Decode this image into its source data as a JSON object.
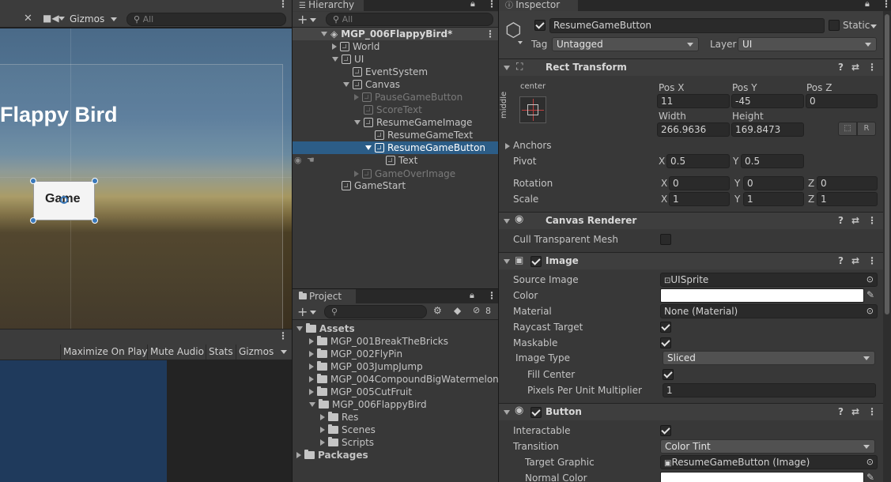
{
  "scene": {
    "toolbar": {
      "gizmos_label": "Gizmos",
      "search_placeholder": "All"
    },
    "title_text": "Flappy Bird",
    "button_text": "Game"
  },
  "game": {
    "toolbar": {
      "maximize": "Maximize On Play",
      "mute": "Mute Audio",
      "stats": "Stats",
      "gizmos": "Gizmos"
    }
  },
  "hierarchy": {
    "tab": "Hierarchy",
    "search_placeholder": "All",
    "scene_name": "MGP_006FlappyBird*",
    "items": [
      {
        "label": "World"
      },
      {
        "label": "UI"
      },
      {
        "label": "EventSystem"
      },
      {
        "label": "Canvas"
      },
      {
        "label": "PauseGameButton"
      },
      {
        "label": "ScoreText"
      },
      {
        "label": "ResumeGameImage"
      },
      {
        "label": "ResumeGameText"
      },
      {
        "label": "ResumeGameButton"
      },
      {
        "label": "Text"
      },
      {
        "label": "GameOverImage"
      },
      {
        "label": "GameStart"
      }
    ]
  },
  "project": {
    "tab": "Project",
    "badge": "8",
    "tree": [
      {
        "label": "Assets"
      },
      {
        "label": "MGP_001BreakTheBricks"
      },
      {
        "label": "MGP_002FlyPin"
      },
      {
        "label": "MGP_003JumpJump"
      },
      {
        "label": "MGP_004CompoundBigWatermelon"
      },
      {
        "label": "MGP_005CutFruit"
      },
      {
        "label": "MGP_006FlappyBird"
      },
      {
        "label": "Res"
      },
      {
        "label": "Scenes"
      },
      {
        "label": "Scripts"
      },
      {
        "label": "Packages"
      }
    ]
  },
  "inspector": {
    "tab": "Inspector",
    "object_name": "ResumeGameButton",
    "static_label": "Static",
    "tag_label": "Tag",
    "tag_value": "Untagged",
    "layer_label": "Layer",
    "layer_value": "UI",
    "rect_transform": {
      "title": "Rect Transform",
      "anchor_h": "center",
      "anchor_v": "middle",
      "pos_x_label": "Pos X",
      "pos_x": "11",
      "pos_y_label": "Pos Y",
      "pos_y": "-45",
      "pos_z_label": "Pos Z",
      "pos_z": "0",
      "width_label": "Width",
      "width": "266.9636",
      "height_label": "Height",
      "height": "169.8473",
      "r_button": "R",
      "anchors_label": "Anchors",
      "pivot_label": "Pivot",
      "pivot_x": "0.5",
      "pivot_y": "0.5",
      "rotation_label": "Rotation",
      "rot_x": "0",
      "rot_y": "0",
      "rot_z": "0",
      "scale_label": "Scale",
      "scale_x": "1",
      "scale_y": "1",
      "scale_z": "1",
      "x": "X",
      "y": "Y",
      "z": "Z"
    },
    "canvas_renderer": {
      "title": "Canvas Renderer",
      "cull_label": "Cull Transparent Mesh"
    },
    "image": {
      "title": "Image",
      "source_label": "Source Image",
      "source_value": "UISprite",
      "color_label": "Color",
      "material_label": "Material",
      "material_value": "None (Material)",
      "raycast_label": "Raycast Target",
      "maskable_label": "Maskable",
      "image_type_label": "Image Type",
      "image_type_value": "Sliced",
      "fill_center_label": "Fill Center",
      "ppu_label": "Pixels Per Unit Multiplier",
      "ppu_value": "1"
    },
    "button": {
      "title": "Button",
      "interactable_label": "Interactable",
      "transition_label": "Transition",
      "transition_value": "Color Tint",
      "target_label": "Target Graphic",
      "target_value": "ResumeGameButton (Image)",
      "normal_color_label": "Normal Color"
    }
  },
  "colors": {
    "selection": "#2c5d87",
    "accent_blue": "#3a79bb",
    "panel": "#383838",
    "toolbar": "#3c3c3c"
  }
}
